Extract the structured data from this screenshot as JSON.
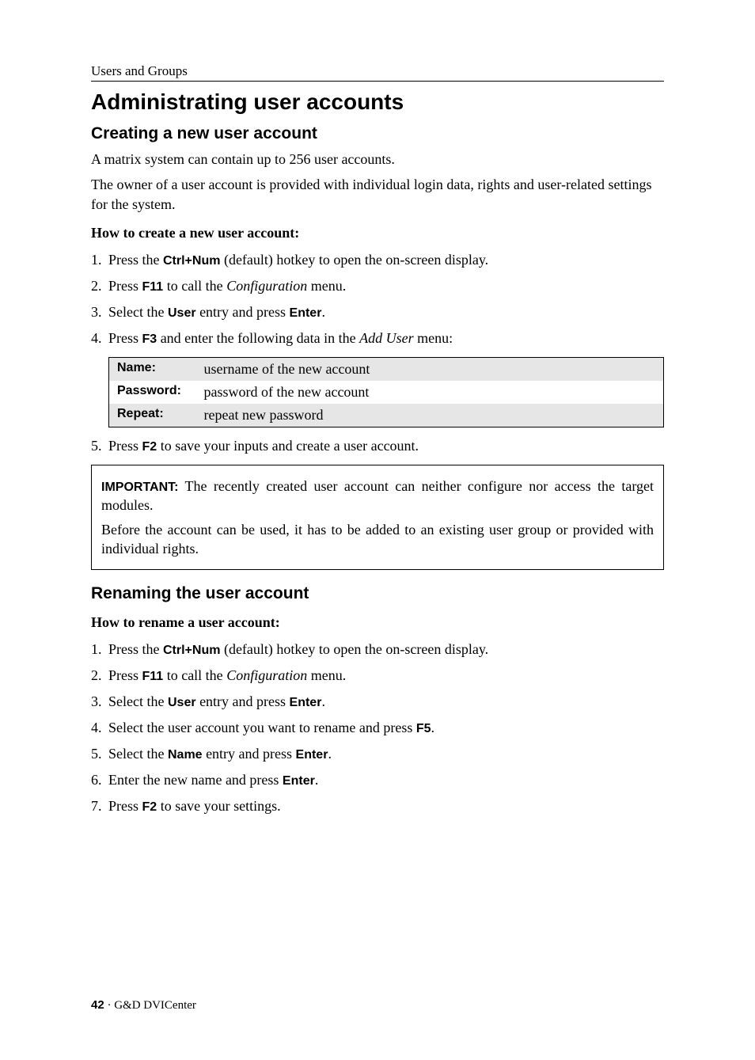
{
  "running_head": "Users and Groups",
  "h1": "Administrating user accounts",
  "section_create": {
    "title": "Creating a new user account",
    "p1": "A matrix system can contain up to 256 user accounts.",
    "p2": "The owner of a user account is provided with individual login data, rights and user-related settings for the system.",
    "howto": "How to create a new user account:",
    "steps": {
      "s1_a": "Press the ",
      "s1_kbd": "Ctrl+Num",
      "s1_b": " (default) hotkey to open the on-screen display.",
      "s2_a": "Press ",
      "s2_kbd": "F11",
      "s2_b": " to call the ",
      "s2_menu": "Configuration",
      "s2_c": " menu.",
      "s3_a": "Select the ",
      "s3_ui": "User",
      "s3_b": " entry and press ",
      "s3_kbd": "Enter",
      "s3_c": ".",
      "s4_a": "Press ",
      "s4_kbd": "F3",
      "s4_b": " and enter the following data in the ",
      "s4_menu": "Add User",
      "s4_c": " menu:",
      "s5_a": "Press ",
      "s5_kbd": "F2",
      "s5_b": " to save your inputs and create a user account."
    },
    "table": {
      "r1_label": "Name:",
      "r1_val": "username of the new account",
      "r2_label": "Password:",
      "r2_val": "password of the new account",
      "r3_label": "Repeat:",
      "r3_val": "repeat new password"
    },
    "note": {
      "label": "IMPORTANT:",
      "p1": " The recently created user account can neither configure nor access the target modules.",
      "p2": "Before the account can be used, it has to be added to an existing user group or provided with individual rights."
    }
  },
  "section_rename": {
    "title": "Renaming the user account",
    "howto": "How to rename a user account:",
    "steps": {
      "s1_a": "Press the ",
      "s1_kbd": "Ctrl+Num",
      "s1_b": " (default) hotkey to open the on-screen display.",
      "s2_a": "Press ",
      "s2_kbd": "F11",
      "s2_b": " to call the ",
      "s2_menu": "Configuration",
      "s2_c": " menu.",
      "s3_a": "Select the ",
      "s3_ui": "User",
      "s3_b": " entry and press ",
      "s3_kbd": "Enter",
      "s3_c": ".",
      "s4_a": "Select the user account you want to rename and press ",
      "s4_kbd": "F5",
      "s4_b": ".",
      "s5_a": "Select the ",
      "s5_ui": "Name",
      "s5_b": " entry and press ",
      "s5_kbd": "Enter",
      "s5_c": ".",
      "s6_a": "Enter the new name and press ",
      "s6_kbd": "Enter",
      "s6_b": ".",
      "s7_a": "Press ",
      "s7_kbd": "F2",
      "s7_b": " to save your settings."
    }
  },
  "footer": {
    "page": "42",
    "sep": " · ",
    "product": "G&D DVICenter"
  }
}
